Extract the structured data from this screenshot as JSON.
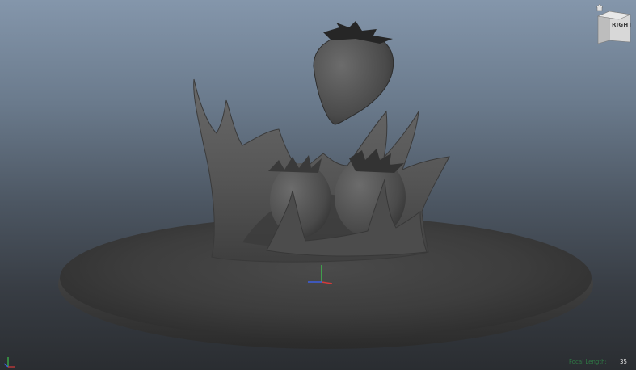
{
  "viewport": {
    "view_cube_label": "RIGHT",
    "hud": {
      "focal_length_label": "Focal Length:",
      "focal_length_value": "35"
    },
    "colors": {
      "background_top": "#8496ab",
      "background_bottom": "#2a2d31",
      "mesh_gray": "#4a4a4a",
      "axis_x": "#d43b3b",
      "axis_y": "#3ec24e",
      "axis_z": "#3d5fe0",
      "hud_label": "#2f7a45"
    },
    "icons": {
      "view_cube": "view-cube-icon",
      "home": "home-icon",
      "origin_axis": "axis-gizmo-icon",
      "corner_axis": "world-axis-icon"
    }
  }
}
